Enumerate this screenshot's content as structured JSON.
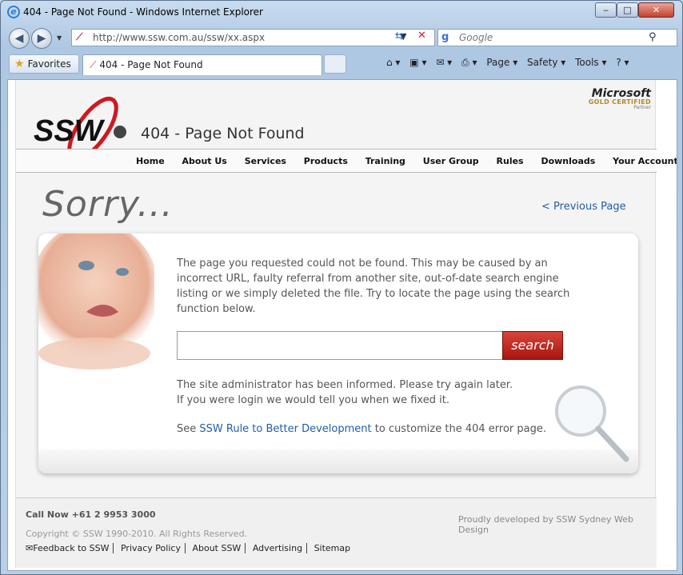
{
  "window": {
    "title": "404 - Page Not Found - Windows Internet Explorer",
    "min_glyph": "‒",
    "max_glyph": "□",
    "close_glyph": "✕"
  },
  "nav": {
    "back_glyph": "◀",
    "forward_glyph": "▶",
    "url": "http://www.ssw.com.au/ssw/xx.aspx",
    "search_placeholder": "Google"
  },
  "tabs": {
    "favorites_label": "Favorites",
    "active_tab_label": "404 - Page Not Found"
  },
  "commandbar": {
    "page": "Page ▾",
    "safety": "Safety ▾",
    "tools": "Tools ▾",
    "help": "? ▾"
  },
  "site": {
    "logo_text": "SSW",
    "page_title": "404 - Page Not Found",
    "partner": {
      "brand": "Microsoft",
      "level": "GOLD CERTIFIED",
      "sub": "Partner"
    },
    "menu": [
      "Home",
      "About Us",
      "Services",
      "Products",
      "Training",
      "User Group",
      "Rules",
      "Downloads",
      "Your Account"
    ]
  },
  "content": {
    "sorry": "Sorry...",
    "previous_page": "< Previous Page",
    "message": "The page you requested could not be found. This may be caused by an incorrect URL, faulty referral from another site, out-of-date search engine listing or we simply deleted the file. Try to locate the page using the search function below.",
    "search_value": "",
    "search_button": "search",
    "admin_line1": "The site administrator has been informed. Please try again later.",
    "admin_line2": "If you were login we would tell you when we fixed it.",
    "see_prefix": "See ",
    "rule_link": "SSW Rule to Better Development",
    "see_suffix": " to customize the 404 error page."
  },
  "footer": {
    "call": "Call Now +61 2 9953 3000",
    "credit": "Proudly developed by SSW Sydney Web Design",
    "copyright": "Copyright © SSW 1990-2010. All Rights Reserved.",
    "links": [
      "✉Feedback to SSW",
      "Privacy Policy",
      "About SSW",
      "Advertising",
      "Sitemap"
    ]
  },
  "colors": {
    "link": "#1f5ea8",
    "search_button": "#b51f16",
    "logo_ring": "#d0181f"
  }
}
